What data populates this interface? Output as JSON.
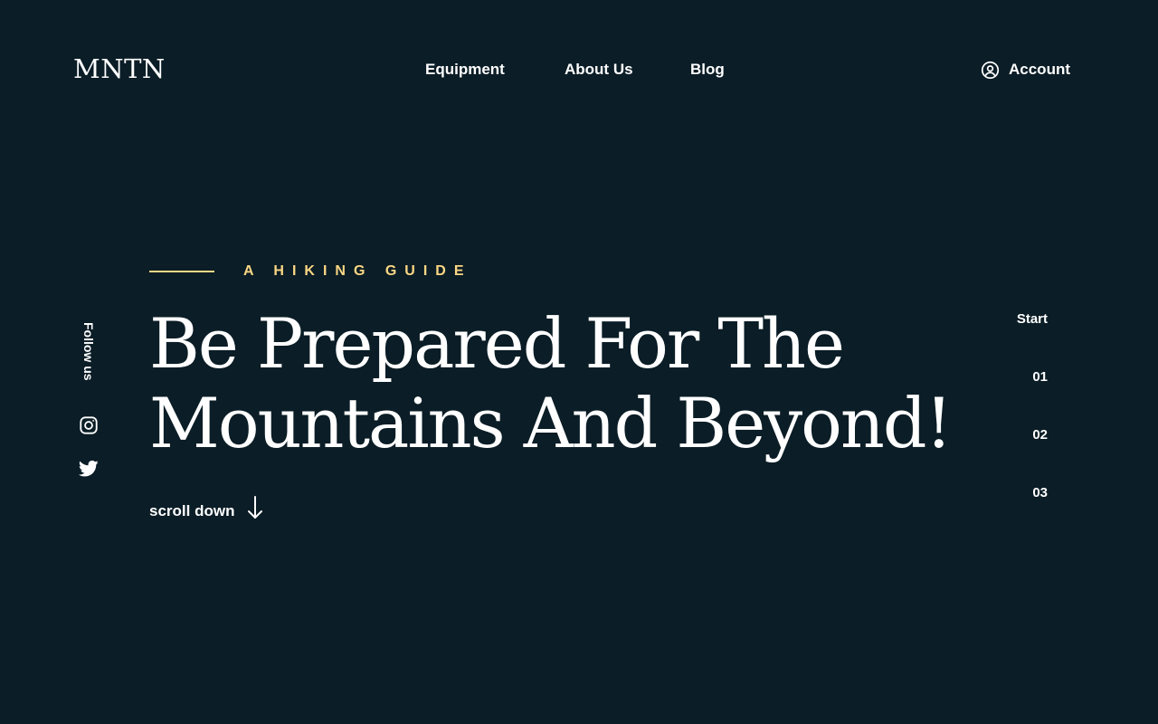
{
  "brand": {
    "logo": "MNTN"
  },
  "nav": {
    "items": [
      {
        "label": "Equipment"
      },
      {
        "label": "About Us"
      },
      {
        "label": "Blog"
      }
    ],
    "account_label": "Account",
    "account_icon": "user-circle-icon"
  },
  "hero": {
    "eyebrow": "A HIKING GUIDE",
    "headline_line1": "Be Prepared For The",
    "headline_line2": "Mountains And Beyond!",
    "scroll_label": "scroll down",
    "scroll_icon": "arrow-down-icon"
  },
  "social": {
    "label": "Follow us",
    "icons": [
      "instagram-icon",
      "twitter-icon"
    ]
  },
  "slides": {
    "start_label": "Start",
    "items": [
      "01",
      "02",
      "03"
    ]
  },
  "colors": {
    "background": "#0b1d26",
    "accent": "#fbd784",
    "text": "#ffffff"
  }
}
